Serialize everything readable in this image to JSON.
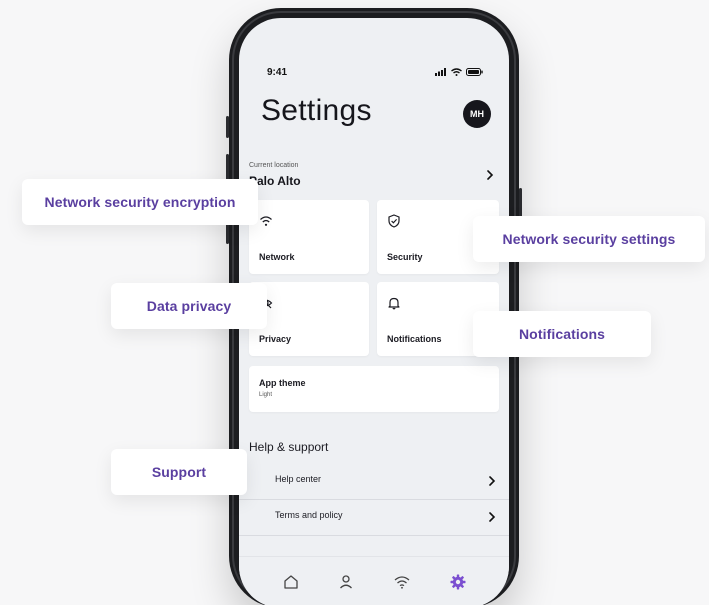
{
  "status_bar": {
    "time": "9:41"
  },
  "header": {
    "title": "Settings",
    "avatar_initials": "MH"
  },
  "location": {
    "caption": "Current location",
    "value": "Palo Alto"
  },
  "tiles": [
    {
      "label": "Network",
      "icon": "wifi-icon"
    },
    {
      "label": "Security",
      "icon": "shield-check-icon"
    },
    {
      "label": "Privacy",
      "icon": "eye-off-icon"
    },
    {
      "label": "Notifications",
      "icon": "bell-icon"
    }
  ],
  "app_theme": {
    "title": "App theme",
    "value": "Light"
  },
  "help_support": {
    "heading": "Help & support",
    "items": [
      {
        "label": "Help center"
      },
      {
        "label": "Terms and policy"
      }
    ]
  },
  "tab_bar": {
    "items": [
      {
        "icon": "home-icon",
        "active": false
      },
      {
        "icon": "person-icon",
        "active": false
      },
      {
        "icon": "wifi-icon",
        "active": false
      },
      {
        "icon": "gear-icon",
        "active": true
      }
    ],
    "accent_color": "#7b4fd0"
  },
  "callouts": {
    "network": "Network security encryption",
    "security": "Network security settings",
    "privacy": "Data privacy",
    "notifications": "Notifications",
    "support": "Support"
  },
  "colors": {
    "callout_text": "#5a3fa0",
    "screen_bg": "#eef0f3",
    "frame": "#1c1d20"
  }
}
